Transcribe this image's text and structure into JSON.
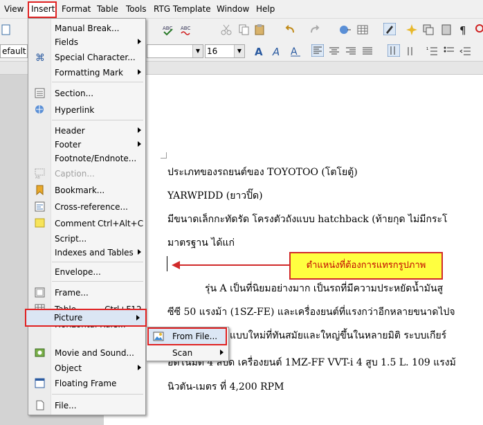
{
  "menubar": {
    "items": [
      "View",
      "Insert",
      "Format",
      "Table",
      "Tools",
      "RTG Template",
      "Window",
      "Help"
    ]
  },
  "formatting": {
    "style_value": "efault",
    "font_size": "16"
  },
  "insert_menu": {
    "items": [
      {
        "label": "Manual Break..."
      },
      {
        "label": "Fields"
      },
      {
        "label": "Special Character..."
      },
      {
        "label": "Formatting Mark"
      },
      {
        "label": "Section..."
      },
      {
        "label": "Hyperlink"
      },
      {
        "label": "Header"
      },
      {
        "label": "Footer"
      },
      {
        "label": "Footnote/Endnote..."
      },
      {
        "label": "Caption..."
      },
      {
        "label": "Bookmark..."
      },
      {
        "label": "Cross-reference..."
      },
      {
        "label": "Comment",
        "shortcut": "Ctrl+Alt+C"
      },
      {
        "label": "Script..."
      },
      {
        "label": "Indexes and Tables"
      },
      {
        "label": "Envelope..."
      },
      {
        "label": "Frame..."
      },
      {
        "label": "Table...",
        "shortcut": "Ctrl+F12"
      },
      {
        "label": "Horizontal Rule..."
      },
      {
        "label": "Picture"
      },
      {
        "label": "Movie and Sound..."
      },
      {
        "label": "Object"
      },
      {
        "label": "Floating Frame"
      },
      {
        "label": "File..."
      }
    ]
  },
  "picture_submenu": {
    "items": [
      {
        "label": "From File..."
      },
      {
        "label": "Scan"
      }
    ]
  },
  "document": {
    "lines": [
      "ประเภทของรถยนต์ของ TOYOTOO (โตโยตู้)",
      "YARWPIDD (ยาวปิ๊ด)",
      "มีขนาดเล็กกะทัดรัด โครงตัวถังแบบ hatchback (ท้ายกุด ไม่มีกระโ",
      "มาตรฐาน ได้แก่",
      "รุ่น A เป็นที่นิยมอย่างมาก เป็นรถที่มีความประหยัดน้ำมันสู",
      "ซีซี 50 แรงม้า (1SZ-FE) และเครื่องยนต์ที่แรงกว่าอีกหลายขนาดไปจ",
      "แบบใหม่ที่ทันสมัยและใหญ่ขึ้นในหลายมิติ ระบบเกียร์",
      "อัตโนมัติ 4 สปีด เครื่องยนต์ 1MZ-FF VVT-i 4 สูบ 1.5 L. 109 แรงม้",
      "นิวตัน-เมตร ที่ 4,200 RPM"
    ]
  },
  "annotation": {
    "callout_text": "ตำแหน่งที่ต้องการแทรกรูปภาพ",
    "color": "#d12a2a",
    "fill": "#ffff40"
  }
}
